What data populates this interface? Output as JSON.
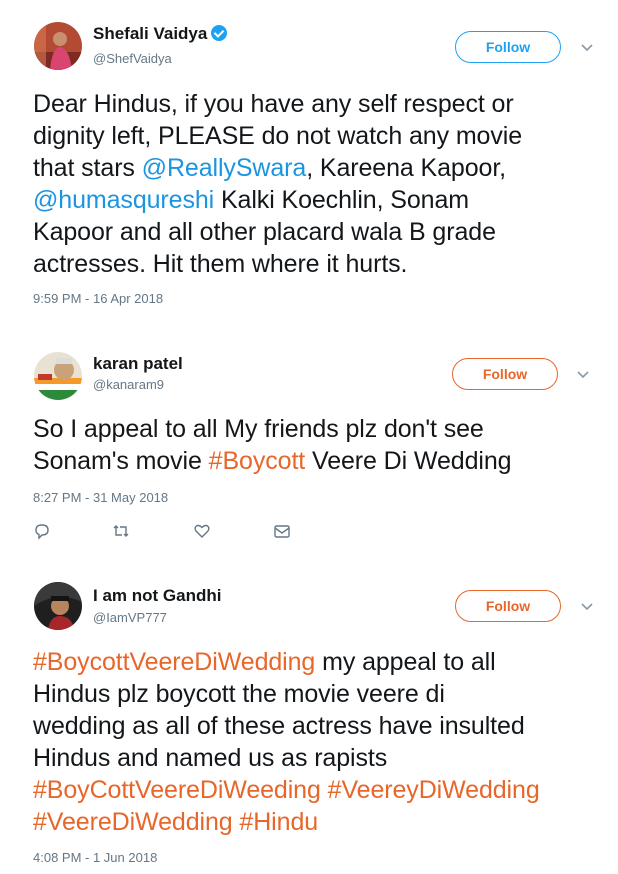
{
  "tweets": [
    {
      "name": "Shefali Vaidya",
      "handle": "@ShefVaidya",
      "verified": true,
      "follow_label": "Follow",
      "body_parts": [
        {
          "t": "Dear Hindus, if you have any self respect or",
          "k": "text"
        },
        {
          "t": "dignity left, PLEASE do not watch any movie",
          "k": "text"
        },
        {
          "t": "that stars ",
          "k": "text"
        },
        {
          "t": "@ReallySwara",
          "k": "mention"
        },
        {
          "t": ", Kareena Kapoor,",
          "k": "text"
        },
        {
          "t": "@humasqureshi",
          "k": "mention"
        },
        {
          "t": " Kalki Koechlin, Sonam",
          "k": "text"
        },
        {
          "t": "Kapoor and all other placard wala B grade",
          "k": "text"
        },
        {
          "t": "actresses. Hit them where it hurts.",
          "k": "text"
        }
      ],
      "timestamp": "9:59 PM - 16 Apr 2018"
    },
    {
      "name": "karan patel",
      "handle": "@kanaram9",
      "verified": false,
      "follow_label": "Follow",
      "body_parts": [
        {
          "t": "So I appeal to all My friends plz don't see",
          "k": "text"
        },
        {
          "t": "Sonam's movie ",
          "k": "text"
        },
        {
          "t": "#Boycott",
          "k": "hash"
        },
        {
          "t": " Veere Di Wedding",
          "k": "text"
        }
      ],
      "timestamp": "8:27 PM - 31 May 2018",
      "actions": [
        "reply-icon",
        "retweet-icon",
        "like-icon",
        "message-icon"
      ]
    },
    {
      "name": "I am not Gandhi",
      "handle": "@IamVP777",
      "verified": false,
      "follow_label": "Follow",
      "body_parts": [
        {
          "t": "#BoycottVeereDiWedding",
          "k": "hash"
        },
        {
          "t": " my appeal to all",
          "k": "text"
        },
        {
          "t": "Hindus plz boycott the movie veere di",
          "k": "text"
        },
        {
          "t": "wedding as all of these actress have insulted",
          "k": "text"
        },
        {
          "t": "Hindus and named us as rapists",
          "k": "text"
        },
        {
          "t": "#BoyCottVeereDiWeeding",
          "k": "hash"
        },
        {
          "t": " ",
          "k": "text"
        },
        {
          "t": "#VeereyDiWedding",
          "k": "hash"
        },
        {
          "t": "#VeereDiWedding",
          "k": "hash"
        },
        {
          "t": " ",
          "k": "text"
        },
        {
          "t": "#Hindu",
          "k": "hash"
        }
      ],
      "timestamp": "4:08 PM - 1 Jun 2018"
    }
  ],
  "colors": {
    "mention": "#1b95e0",
    "hashtag": "#e8662a",
    "follow_blue": "#1da1f2",
    "follow_orange": "#e8662a",
    "meta": "#657786"
  }
}
